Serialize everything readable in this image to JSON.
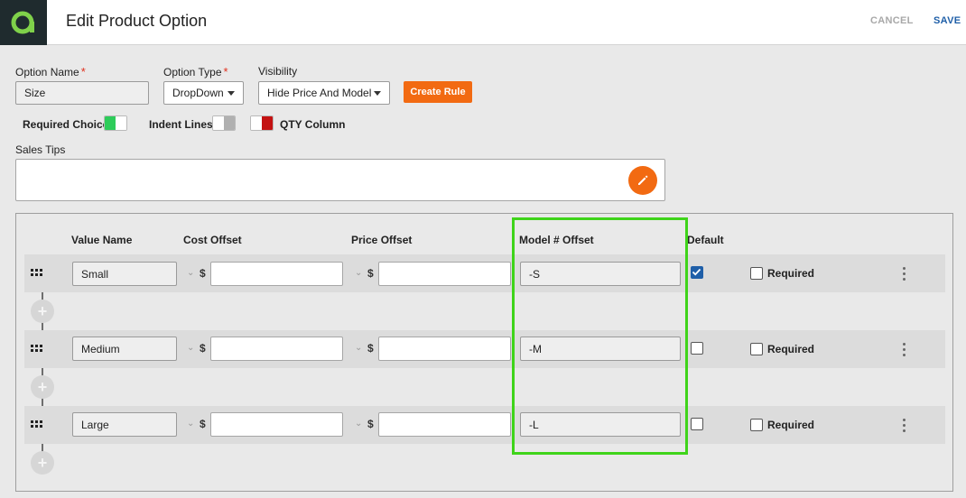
{
  "header": {
    "title": "Edit Product Option",
    "cancel_label": "CANCEL",
    "save_label": "SAVE"
  },
  "form": {
    "option_name": {
      "label": "Option Name",
      "value": "Size"
    },
    "option_type": {
      "label": "Option Type",
      "value": "DropDown"
    },
    "visibility": {
      "label": "Visibility",
      "value": "Hide Price And Model"
    },
    "create_rule_label": "Create Rule",
    "toggles": {
      "required_choice": "Required Choice",
      "indent_lines": "Indent Lines",
      "qty_column": "QTY Column"
    },
    "sales_tips": {
      "label": "Sales Tips",
      "value": ""
    },
    "required_mark": "*"
  },
  "colors": {
    "accent": "#f26a12",
    "primary": "#1f5fa8",
    "toggle_on": "#2ecc5a",
    "toggle_red": "#c41212",
    "highlight": "#3fd41a"
  },
  "table": {
    "headers": {
      "value_name": "Value Name",
      "cost_offset": "Cost Offset",
      "price_offset": "Price Offset",
      "model_offset": "Model # Offset",
      "default": "Default"
    },
    "currency": "$",
    "required_label": "Required",
    "rows": [
      {
        "value_name": "Small",
        "cost_offset": "",
        "price_offset": "",
        "model_offset": "-S",
        "default": true,
        "required": false
      },
      {
        "value_name": "Medium",
        "cost_offset": "",
        "price_offset": "",
        "model_offset": "-M",
        "default": false,
        "required": false
      },
      {
        "value_name": "Large",
        "cost_offset": "",
        "price_offset": "",
        "model_offset": "-L",
        "default": false,
        "required": false
      }
    ]
  }
}
